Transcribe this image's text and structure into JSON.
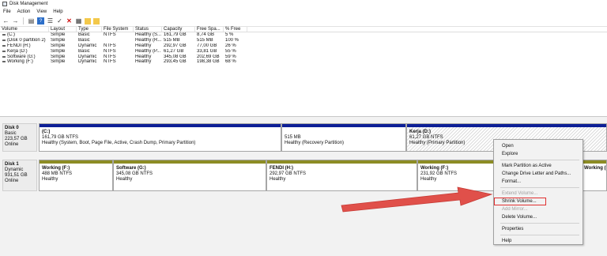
{
  "window": {
    "title": "Disk Management"
  },
  "menu": [
    "File",
    "Action",
    "View",
    "Help"
  ],
  "toolbar": {
    "icons": [
      "back-icon",
      "forward-icon",
      "console-icon",
      "help-icon",
      "list-icon",
      "check-icon",
      "delete-icon",
      "properties-icon",
      "folder-icon",
      "wizard-icon"
    ]
  },
  "table": {
    "headers": [
      "Volume",
      "Layout",
      "Type",
      "File System",
      "Status",
      "Capacity",
      "Free Spa...",
      "% Free"
    ],
    "rows": [
      [
        "(C:)",
        "Simple",
        "Basic",
        "NTFS",
        "Healthy (S...",
        "161,79 GB",
        "8,74 GB",
        "5 %"
      ],
      [
        "(Disk 0 partition 2)",
        "Simple",
        "Basic",
        "",
        "Healthy (R...",
        "515 MB",
        "515 MB",
        "100 %"
      ],
      [
        "FENDI (H:)",
        "Simple",
        "Dynamic",
        "NTFS",
        "Healthy",
        "292,97 GB",
        "77,00 GB",
        "26 %"
      ],
      [
        "Kerja (D:)",
        "Simple",
        "Basic",
        "NTFS",
        "Healthy (P...",
        "61,27 GB",
        "33,81 GB",
        "55 %"
      ],
      [
        "Software (G:)",
        "Simple",
        "Dynamic",
        "NTFS",
        "Healthy",
        "345,08 GB",
        "202,69 GB",
        "59 %"
      ],
      [
        "Working (F:)",
        "Simple",
        "Dynamic",
        "NTFS",
        "Healthy",
        "293,45 GB",
        "198,38 GB",
        "68 %"
      ]
    ]
  },
  "disk0": {
    "name": "Disk 0",
    "type": "Basic",
    "size": "223,57 GB",
    "state": "Online",
    "partitions": [
      {
        "title": "(C:)",
        "size": "161,79 GB NTFS",
        "status": "Healthy (System, Boot, Page File, Active, Crash Dump, Primary Partition)"
      },
      {
        "title": "",
        "size": "515 MB",
        "status": "Healthy (Recovery Partition)"
      },
      {
        "title": "Kerja (D:)",
        "size": "61,27 GB NTFS",
        "status": "Healthy (Primary Partition)"
      }
    ]
  },
  "disk1": {
    "name": "Disk 1",
    "type": "Dynamic",
    "size": "931,51 GB",
    "state": "Online",
    "partitions": [
      {
        "title": "Working (F:)",
        "size": "488 MB NTFS",
        "status": "Healthy"
      },
      {
        "title": "Software (G:)",
        "size": "345,08 GB NTFS",
        "status": "Healthy"
      },
      {
        "title": "FENDI (H:)",
        "size": "292,97 GB NTFS",
        "status": "Healthy"
      },
      {
        "title": "Working (F:)",
        "size": "231,92 GB NTFS",
        "status": "Healthy"
      },
      {
        "title": "Working (F:)",
        "size": "",
        "status": ""
      }
    ]
  },
  "context_menu": {
    "items": [
      "Open",
      "Explore",
      "Mark Partition as Active",
      "Change Drive Letter and Paths...",
      "Format...",
      "Extend Volume...",
      "Shrink Volume...",
      "Add Mirror...",
      "Delete Volume...",
      "Properties",
      "Help"
    ]
  },
  "colors": {
    "primary_partition": "#0d1f96",
    "simple_volume": "#8c8c24",
    "highlight": "#e03030"
  }
}
